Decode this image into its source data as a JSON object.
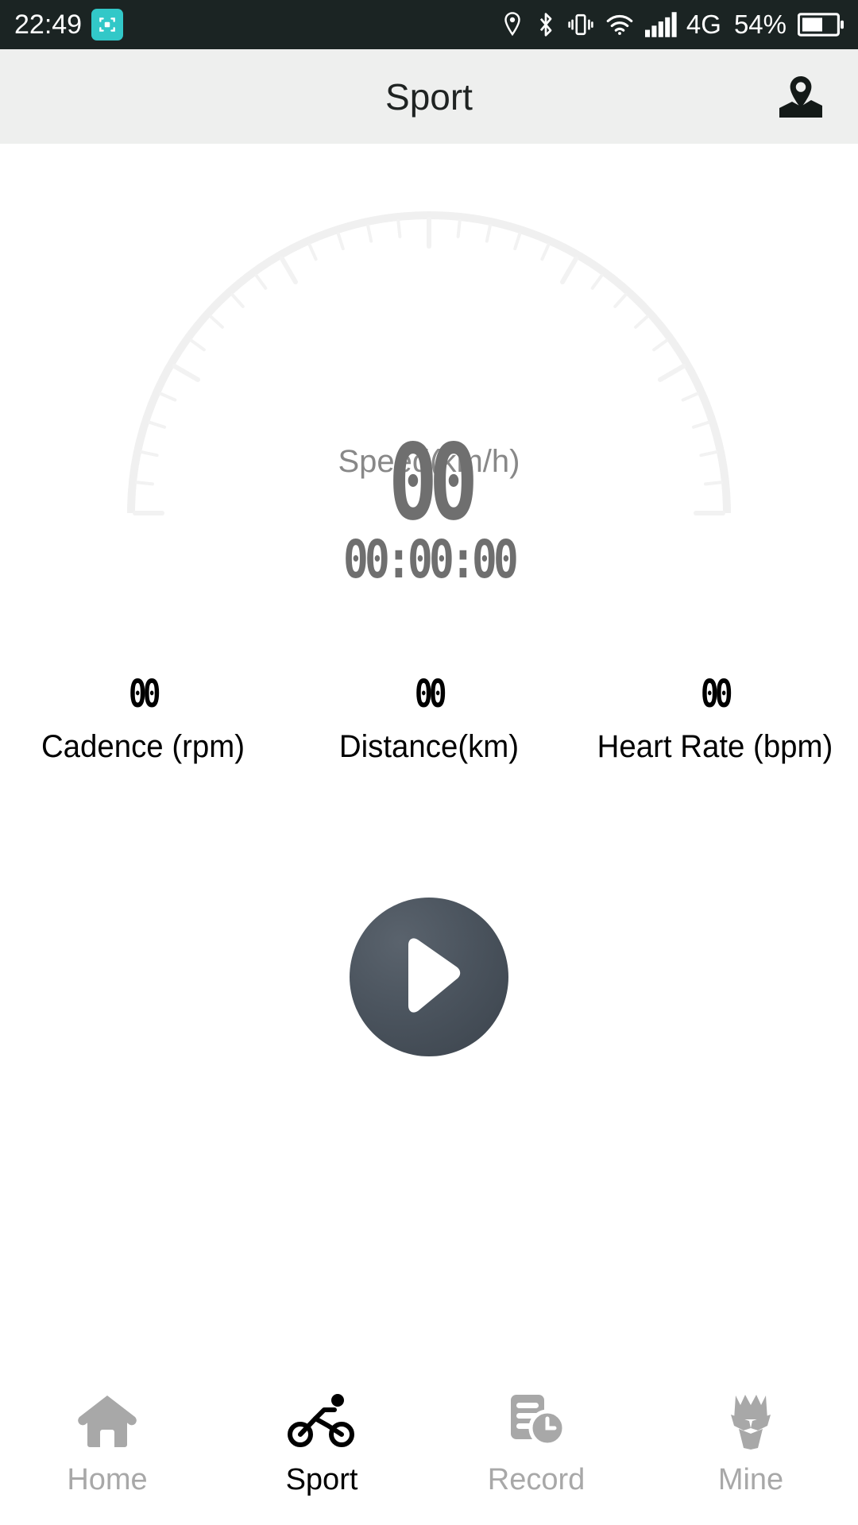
{
  "status_bar": {
    "time": "22:49",
    "cast_icon": "screen-cast-icon",
    "icons": [
      "location-icon",
      "bluetooth-icon",
      "vibrate-icon",
      "wifi-icon",
      "signal-bars-icon"
    ],
    "network": "4G",
    "battery_percent": "54%",
    "battery_icon": "battery-icon",
    "background_color": "#1b2423",
    "foreground_color": "#ffffff",
    "cast_badge_color": "#32c8c8"
  },
  "header": {
    "title": "Sport",
    "map_icon": "map-location-icon",
    "background_color": "#eeefee",
    "title_color": "#1f2322"
  },
  "gauge": {
    "label": "Speed(km/h)",
    "label_color": "#888888",
    "arc_color": "#f0f0f0",
    "tick_color": "#f2f2f2",
    "tick_count": 31,
    "min_value": 0,
    "max_value": 60
  },
  "readouts": {
    "speed_value": "00",
    "timer_value": "00:00:00",
    "value_color": "#6f6f6f"
  },
  "metrics": [
    {
      "value": "00",
      "label": "Cadence (rpm)",
      "name": "cadence"
    },
    {
      "value": "00",
      "label": "Distance(km)",
      "name": "distance"
    },
    {
      "value": "00",
      "label": "Heart Rate (bpm)",
      "name": "heart-rate"
    }
  ],
  "start_button": {
    "icon": "play-icon",
    "gradient_from": "#5a636d",
    "gradient_to": "#3b434c",
    "icon_color": "#ffffff"
  },
  "bottom_nav": {
    "active_color": "#000000",
    "inactive_color": "#a8a8a8",
    "items": [
      {
        "label": "Home",
        "icon": "home-icon",
        "active": false
      },
      {
        "label": "Sport",
        "icon": "cycling-icon",
        "active": true
      },
      {
        "label": "Record",
        "icon": "record-clock-icon",
        "active": false
      },
      {
        "label": "Mine",
        "icon": "profile-icon",
        "active": false
      }
    ]
  }
}
